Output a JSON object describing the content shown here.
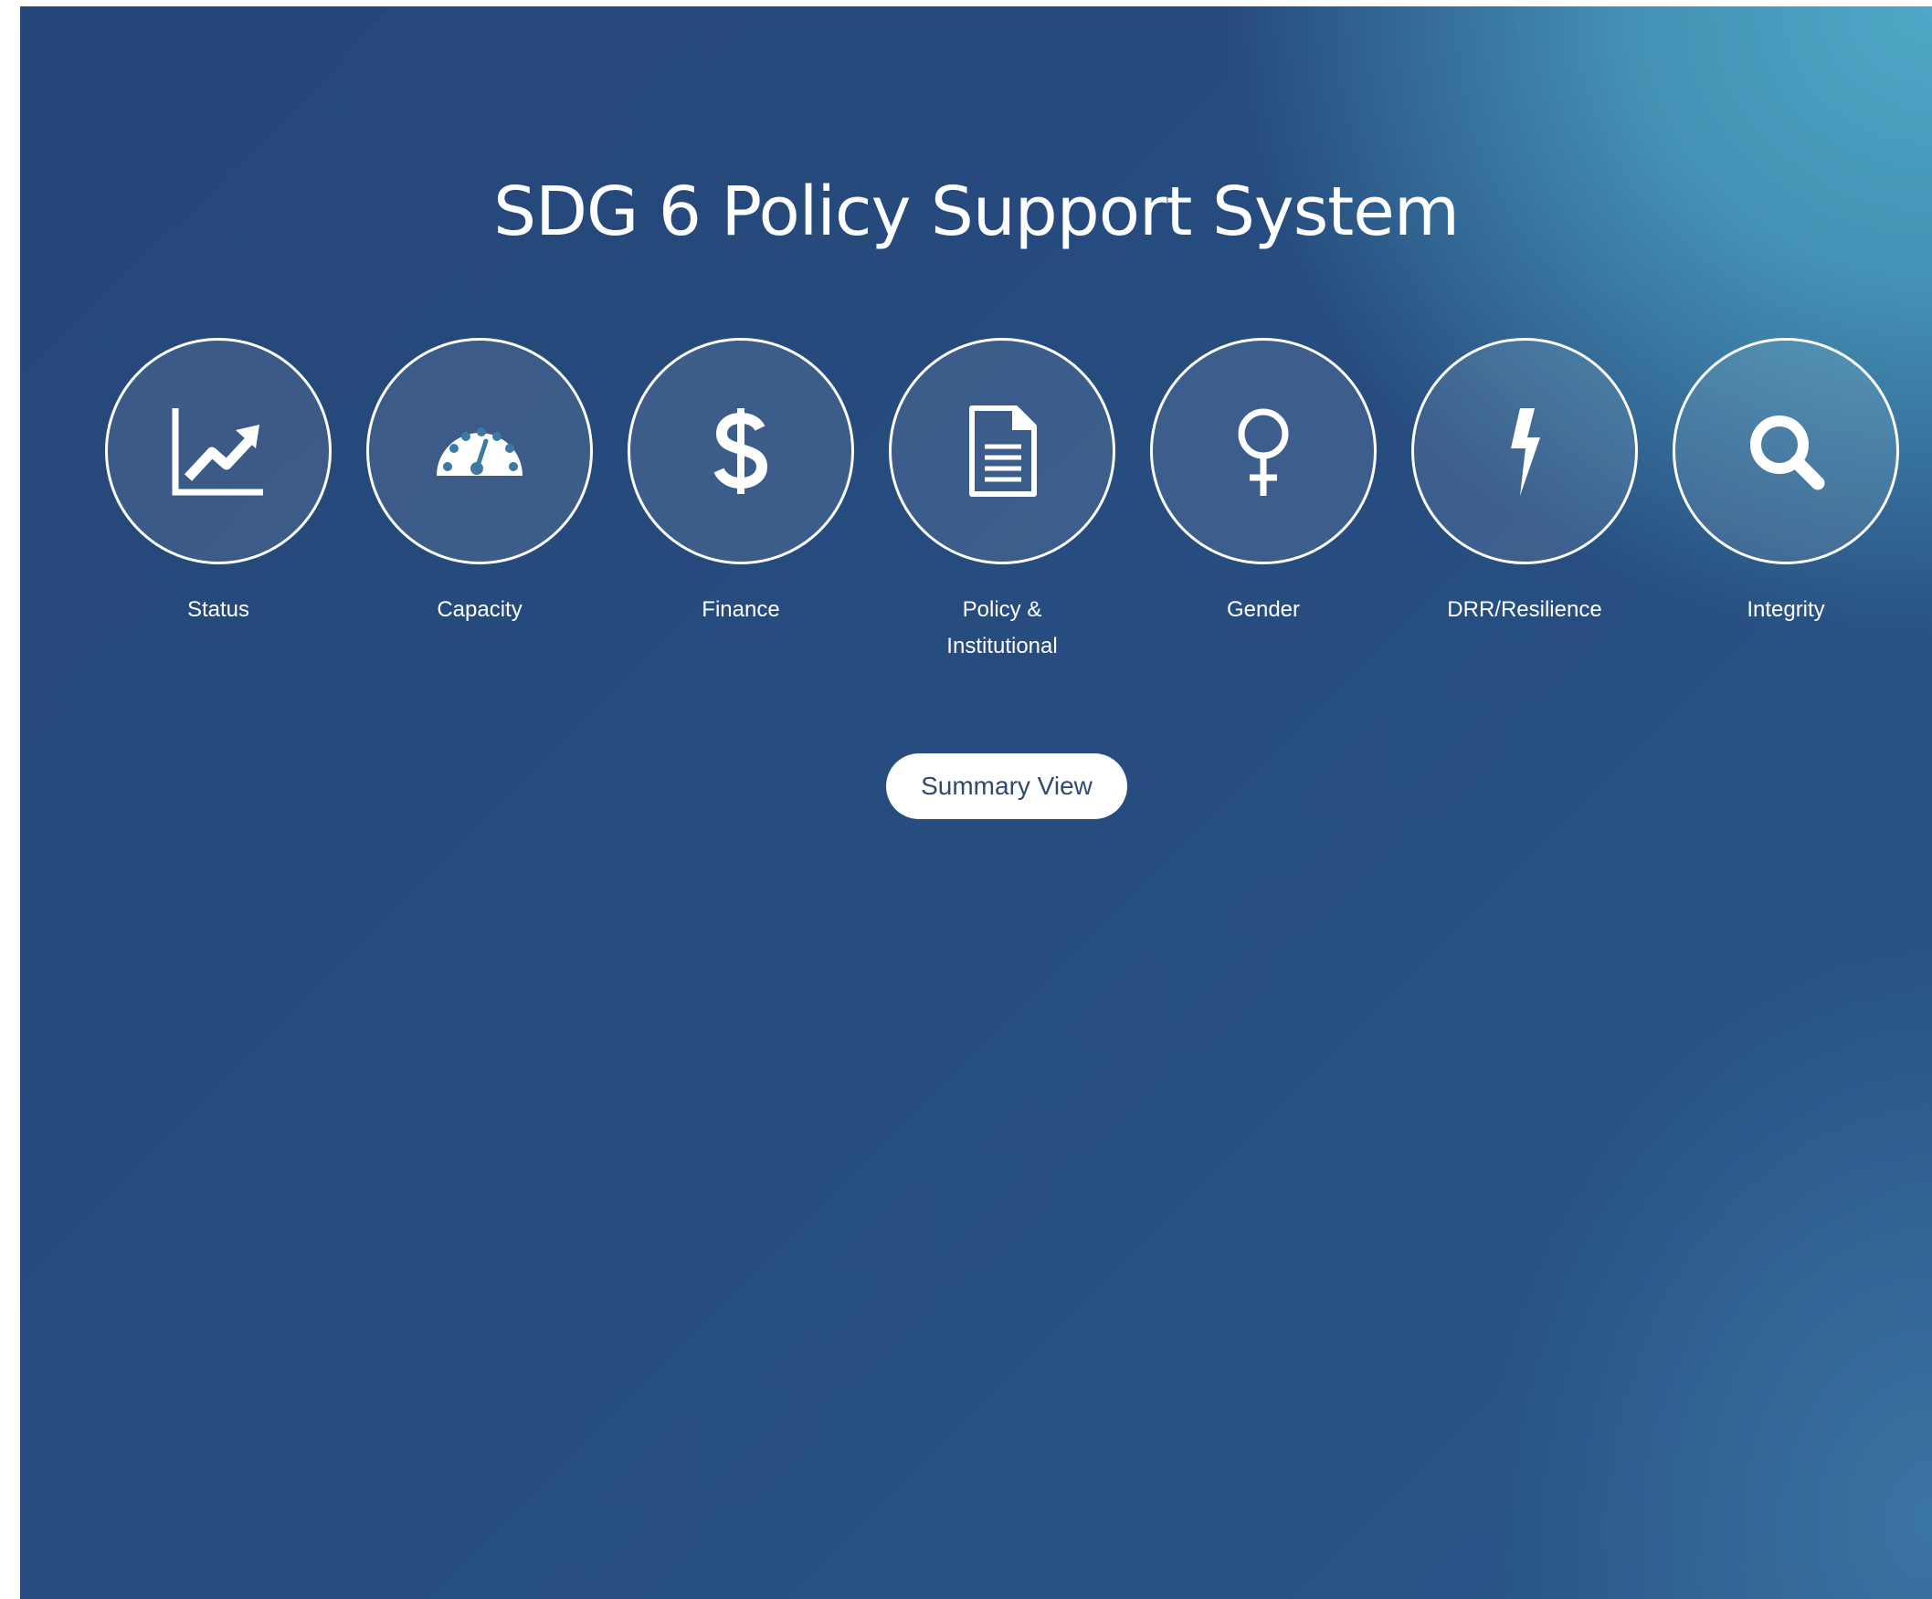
{
  "page_title": "SDG 6 Policy Support System",
  "nav_items": [
    {
      "label": "Status",
      "icon": "line-chart-icon"
    },
    {
      "label": "Capacity",
      "icon": "speedometer-icon"
    },
    {
      "label": "Finance",
      "icon": "dollar-icon"
    },
    {
      "label": "Policy &\nInstitutional",
      "icon": "document-icon"
    },
    {
      "label": "Gender",
      "icon": "female-symbol-icon"
    },
    {
      "label": "DRR/Resilience",
      "icon": "lightning-bolt-icon"
    },
    {
      "label": "Integrity",
      "icon": "magnifying-glass-icon"
    }
  ],
  "summary_button_label": "Summary View",
  "colors": {
    "background_dark": "#254678",
    "background_light": "#4ea8c6",
    "foreground": "#ffffff",
    "button_text": "#2f4a6e"
  }
}
